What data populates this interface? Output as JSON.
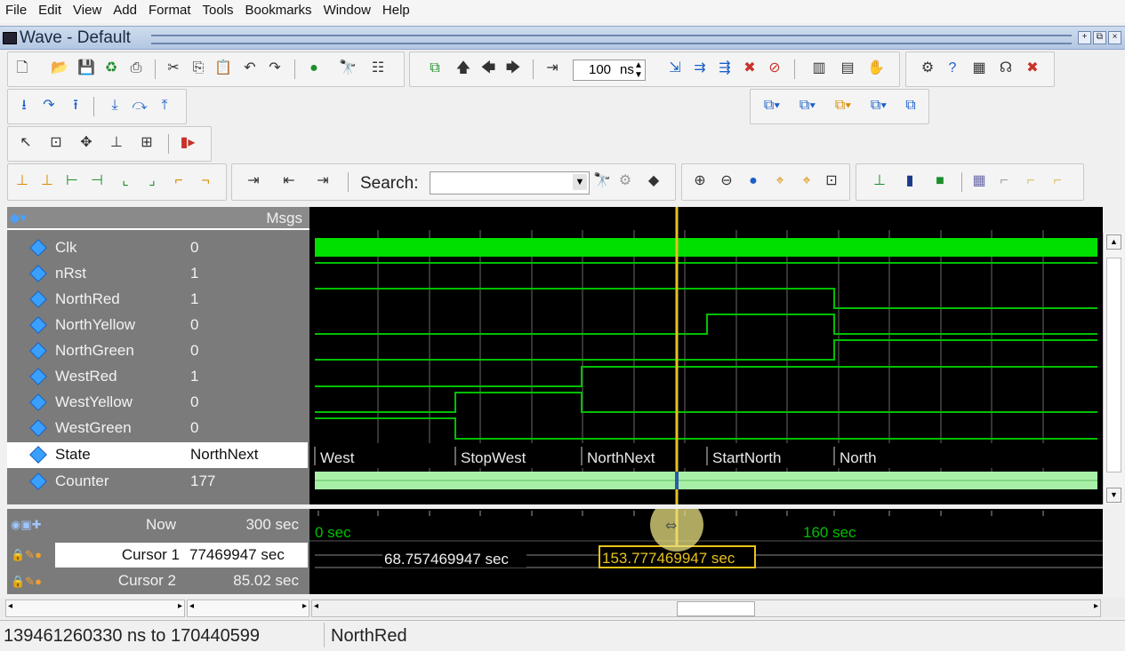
{
  "menu": [
    "File",
    "Edit",
    "View",
    "Add",
    "Format",
    "Tools",
    "Bookmarks",
    "Window",
    "Help"
  ],
  "window": {
    "title": "Wave - Default"
  },
  "toolbar": {
    "time_value": "100",
    "time_unit": "ns",
    "search_label": "Search:",
    "search_value": ""
  },
  "wave_pane": {
    "msgs_header": "Msgs",
    "signals": [
      {
        "name": "Clk",
        "value": "0"
      },
      {
        "name": "nRst",
        "value": "1"
      },
      {
        "name": "NorthRed",
        "value": "1"
      },
      {
        "name": "NorthYellow",
        "value": "0"
      },
      {
        "name": "NorthGreen",
        "value": "0"
      },
      {
        "name": "WestRed",
        "value": "1"
      },
      {
        "name": "WestYellow",
        "value": "0"
      },
      {
        "name": "WestGreen",
        "value": "0"
      },
      {
        "name": "State",
        "value": "NorthNext"
      },
      {
        "name": "Counter",
        "value": "177"
      }
    ],
    "state_labels": [
      "West",
      "StopWest",
      "NorthNext",
      "StartNorth",
      "North"
    ]
  },
  "time_pane": {
    "now_label": "Now",
    "now_value": "300 sec",
    "cursor1_label": "Cursor 1",
    "cursor1_value": "77469947 sec",
    "cursor2_label": "Cursor 2",
    "cursor2_value": "85.02 sec",
    "axis_labels": [
      "0 sec",
      "160 sec"
    ],
    "cursor2_readout": "68.757469947 sec",
    "cursor1_readout": "153.777469947 sec"
  },
  "status": {
    "range": "139461260330 ns to 170440599",
    "signal": "NorthRed"
  },
  "colors": {
    "wave_green": "#00c000",
    "clk_green": "#00e000",
    "cursor_yellow": "#e8c21a",
    "counter_fill": "#a8f0a8"
  }
}
